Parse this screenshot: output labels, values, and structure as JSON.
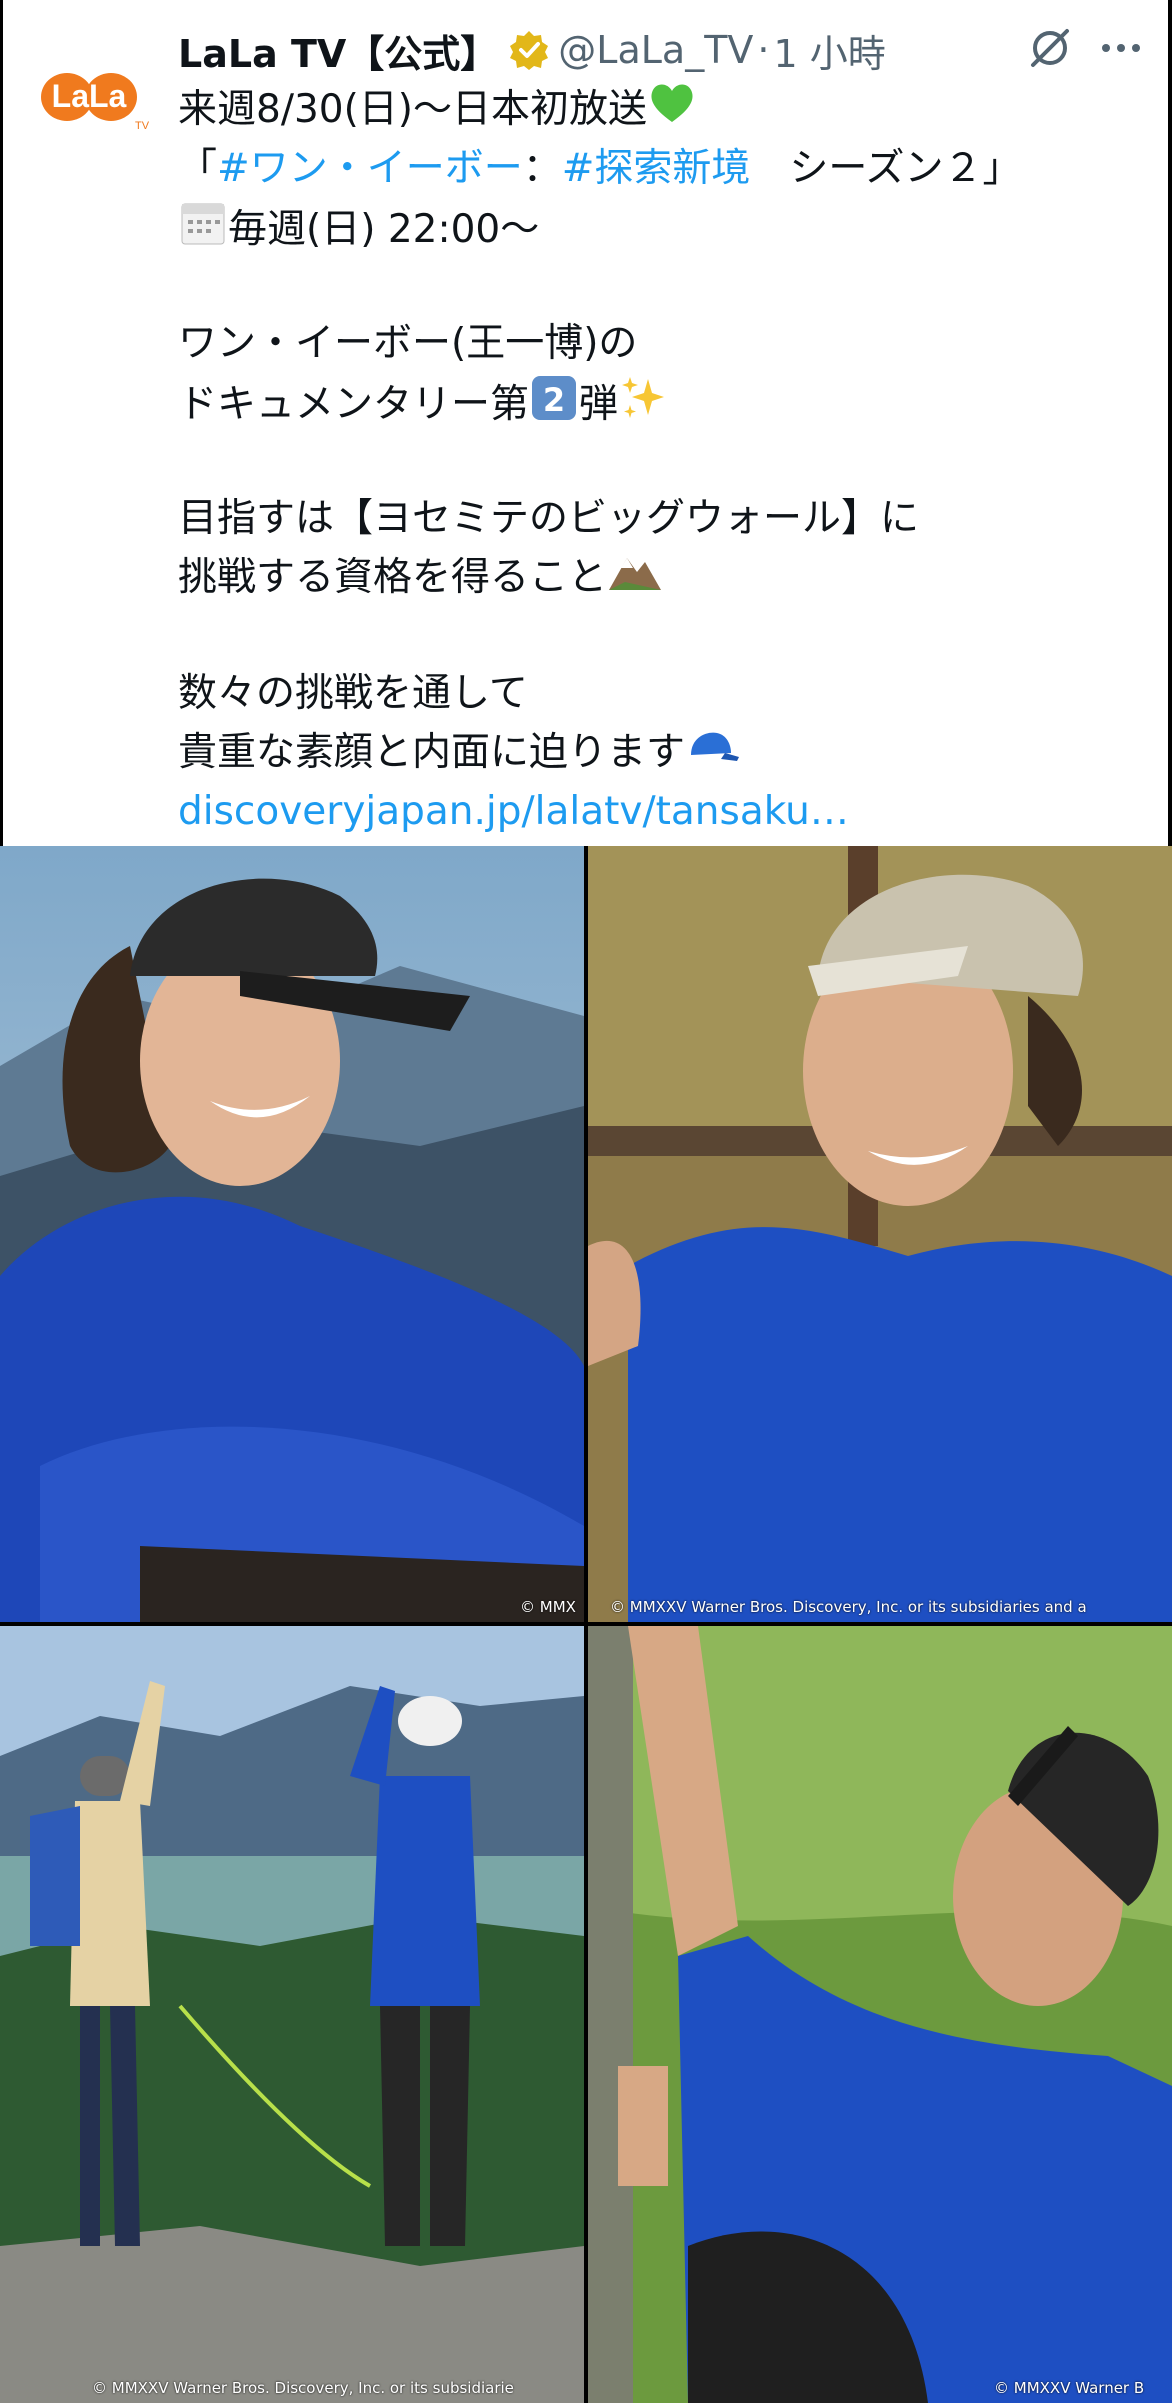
{
  "post": {
    "display_name": "LaLa TV【公式】",
    "handle": "@LaLa_TV",
    "separator": "·",
    "time": "1 小時",
    "lines": {
      "l1": "来週8/30(日)～日本初放送",
      "l2_open": "「",
      "l2_tag1": "#ワン・イーボー",
      "l2_colon": "：",
      "l2_tag2": "#探索新境",
      "l2_rest": "　シーズン２」",
      "l3": "毎週(日) 22:00～",
      "l4": "ワン・イーボー(王一博)の",
      "l5_a": "ドキュメンタリー第",
      "l5_b": "弾",
      "l6": "目指すは【ヨセミテのビッグウォール】に",
      "l7": "挑戦する資格を得ること",
      "l8": "数々の挑戦を通して",
      "l9": "貴重な素顔と内面に迫ります",
      "link": "discoveryjapan.jp/lalatv/tansaku…"
    }
  },
  "avatar": {
    "text": "LaLa",
    "sub": "TV"
  },
  "media": {
    "copyright_1a": "© MMX",
    "copyright_1b": "© MMXXV Warner Bros. Discovery, Inc. or its subsidiaries and a",
    "copyright_2": "© MMXXV Warner Bros. Discovery, Inc. or its subsidiarie",
    "copyright_3": "© MMXXV Warner B"
  },
  "colors": {
    "link": "#1d9bf0",
    "brand_orange": "#f07a1e",
    "shirt_blue": "#1e47b8"
  },
  "icons": [
    "verified-badge-icon",
    "grok-icon",
    "more-icon",
    "green-heart-emoji",
    "calendar-emoji",
    "keycap-2-emoji",
    "sparkles-emoji",
    "mountain-emoji",
    "blue-cap-emoji"
  ]
}
